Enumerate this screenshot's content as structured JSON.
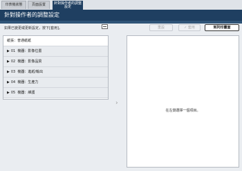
{
  "tabs": [
    {
      "label": "印表機狀態"
    },
    {
      "label": "頁面設置"
    },
    {
      "label": "針對操作者的調整設定"
    }
  ],
  "title": "針對操作者的調整設定",
  "instruction": "如果已變更或更新設定，按下[套用]。",
  "buttons": {
    "reset": "重設",
    "apply_icon": "✓",
    "apply": "套用",
    "print_page": "到列印畫面"
  },
  "paper": {
    "label": "紙張：",
    "value": "普通紙紙"
  },
  "categories": [
    {
      "code": "01",
      "label": "機器：影像位置"
    },
    {
      "code": "02",
      "label": "機器：影像品質"
    },
    {
      "code": "03",
      "label": "機器：進紙/輸出"
    },
    {
      "code": "04",
      "label": "機器：生產力"
    },
    {
      "code": "05",
      "label": "機器：維護"
    }
  ],
  "right_panel_message": "在左側選擇一個項目。"
}
